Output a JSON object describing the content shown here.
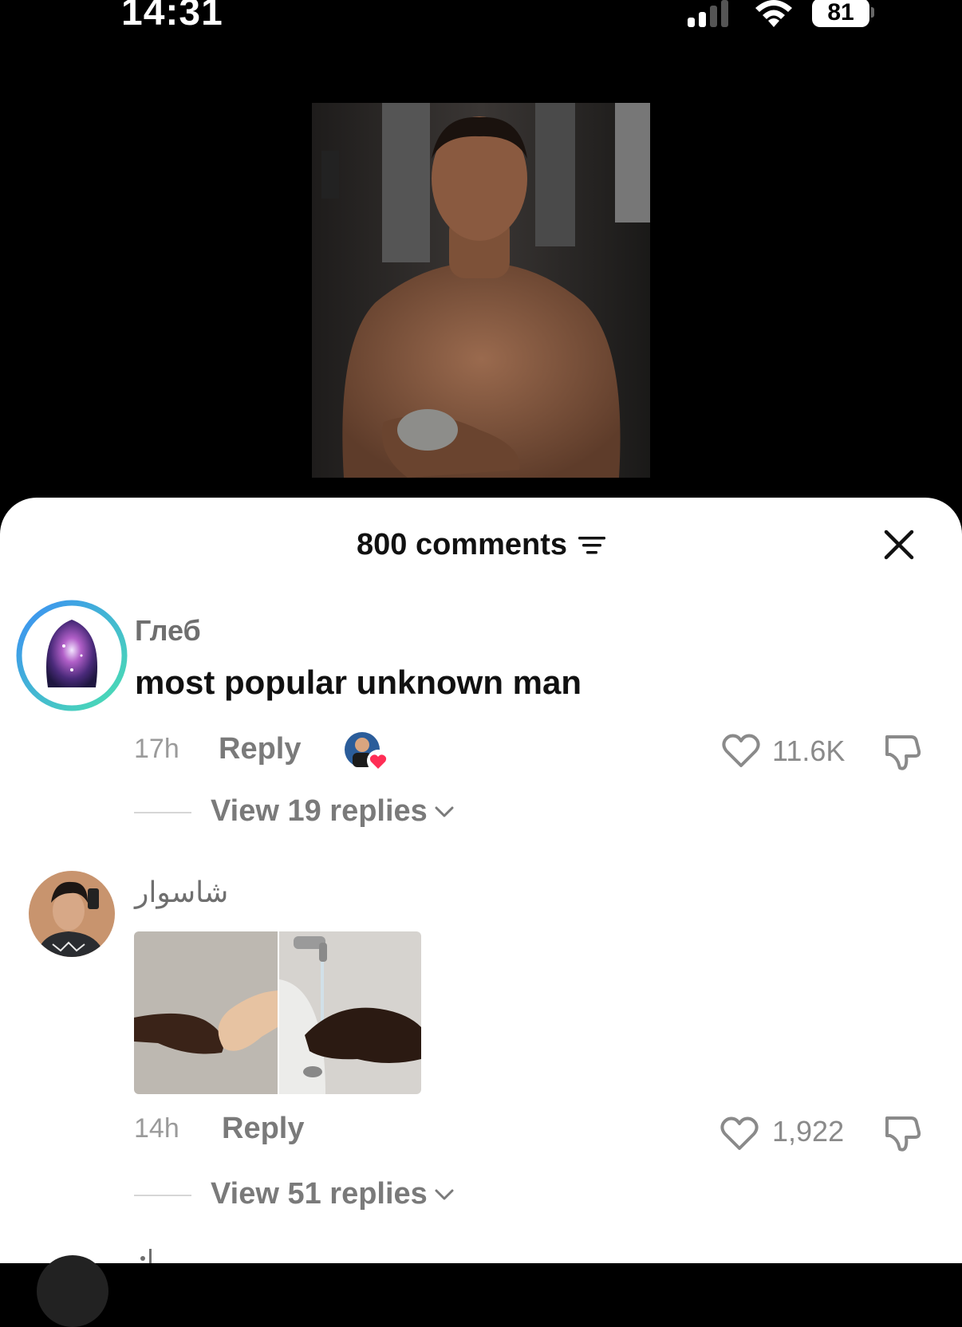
{
  "status_bar": {
    "time": "14:31",
    "battery": "81"
  },
  "sheet": {
    "title": "800 comments"
  },
  "comments": [
    {
      "username": "Глеб",
      "text": "most popular unknown man",
      "time": "17h",
      "reply_label": "Reply",
      "likes": "11.6K",
      "view_replies": "View 19 replies"
    },
    {
      "username": "شاسوار",
      "time": "14h",
      "reply_label": "Reply",
      "likes": "1,922",
      "view_replies": "View 51 replies"
    }
  ],
  "colors": {
    "accent_like": "#ff2d55",
    "text_muted": "#7a7a7a"
  }
}
